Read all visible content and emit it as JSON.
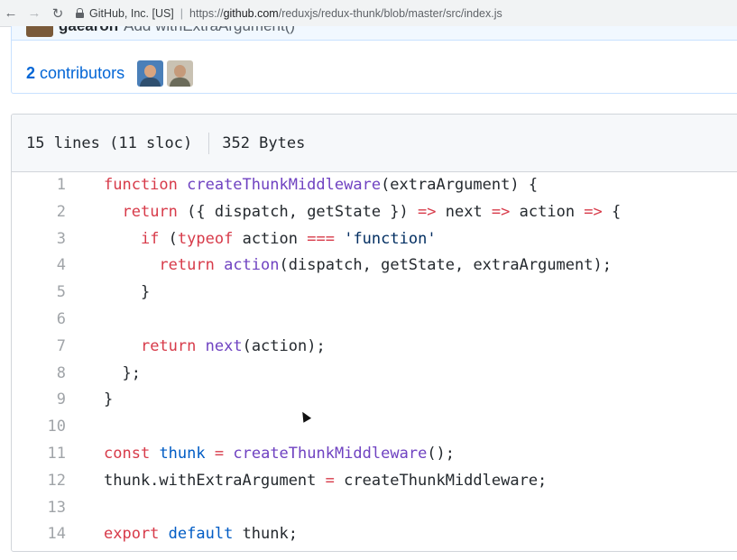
{
  "browser": {
    "ev_label": "GitHub, Inc. [US]",
    "separator": "|",
    "url_scheme": "https://",
    "url_host": "github.com",
    "url_path": "/reduxjs/redux-thunk/blob/master/src/index.js"
  },
  "commit": {
    "author": "gaearon",
    "message": "Add withExtraArgument()"
  },
  "contributors": {
    "count": "2",
    "label": "contributors"
  },
  "file": {
    "lines_info": "15 lines (11 sloc)",
    "size": "352 Bytes"
  },
  "code_lines": [
    {
      "n": "1",
      "t": [
        [
          "kw",
          "function "
        ],
        [
          "fn",
          "createThunkMiddleware"
        ],
        [
          "",
          "(extraArgument) {"
        ]
      ]
    },
    {
      "n": "2",
      "t": [
        [
          "",
          "  "
        ],
        [
          "kw",
          "return"
        ],
        [
          "",
          " ({ dispatch, getState }) "
        ],
        [
          "kw",
          "=>"
        ],
        [
          "",
          " next "
        ],
        [
          "kw",
          "=>"
        ],
        [
          "",
          " action "
        ],
        [
          "kw",
          "=>"
        ],
        [
          "",
          " {"
        ]
      ]
    },
    {
      "n": "3",
      "t": [
        [
          "",
          "    "
        ],
        [
          "kw",
          "if"
        ],
        [
          "",
          " ("
        ],
        [
          "kw",
          "typeof"
        ],
        [
          "",
          " action "
        ],
        [
          "kw",
          "==="
        ],
        [
          "",
          " "
        ],
        [
          "str",
          "'function'"
        ],
        [
          ") {"
        ]
      ]
    },
    {
      "n": "4",
      "t": [
        [
          "",
          "      "
        ],
        [
          "kw",
          "return"
        ],
        [
          "",
          " "
        ],
        [
          "fn",
          "action"
        ],
        [
          "",
          "(dispatch, getState, extraArgument);"
        ]
      ]
    },
    {
      "n": "5",
      "t": [
        [
          "",
          "    }"
        ]
      ]
    },
    {
      "n": "6",
      "t": [
        [
          "",
          ""
        ]
      ]
    },
    {
      "n": "7",
      "t": [
        [
          "",
          "    "
        ],
        [
          "kw",
          "return"
        ],
        [
          "",
          " "
        ],
        [
          "fn",
          "next"
        ],
        [
          "",
          "(action);"
        ]
      ]
    },
    {
      "n": "8",
      "t": [
        [
          "",
          "  };"
        ]
      ]
    },
    {
      "n": "9",
      "t": [
        [
          "",
          "}"
        ]
      ]
    },
    {
      "n": "10",
      "t": [
        [
          "",
          ""
        ]
      ]
    },
    {
      "n": "11",
      "t": [
        [
          "kw",
          "const"
        ],
        [
          "",
          " "
        ],
        [
          "cn",
          "thunk"
        ],
        [
          "",
          " "
        ],
        [
          "kw",
          "="
        ],
        [
          "",
          " "
        ],
        [
          "fn",
          "createThunkMiddleware"
        ],
        [
          "",
          "();"
        ]
      ]
    },
    {
      "n": "12",
      "t": [
        [
          "",
          "thunk.withExtraArgument "
        ],
        [
          "kw",
          "="
        ],
        [
          "",
          " createThunkMiddleware;"
        ]
      ]
    },
    {
      "n": "13",
      "t": [
        [
          "",
          ""
        ]
      ]
    },
    {
      "n": "14",
      "t": [
        [
          "kw",
          "export"
        ],
        [
          "",
          " "
        ],
        [
          "cn",
          "default"
        ],
        [
          "",
          " thunk;"
        ]
      ]
    }
  ],
  "icons": {
    "back": "back-arrow-icon",
    "forward": "forward-arrow-icon",
    "reload": "reload-icon",
    "lock": "lock-icon"
  },
  "colors": {
    "keyword": "#d73a49",
    "function": "#6f42c1",
    "string": "#032f62",
    "constant": "#005cc5",
    "link": "#0366d6"
  }
}
